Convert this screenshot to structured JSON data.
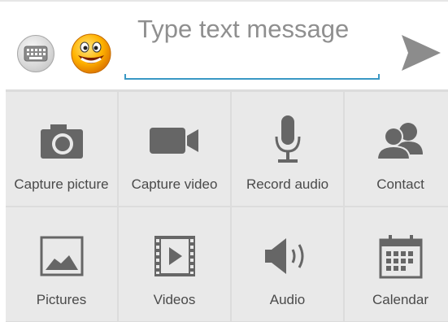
{
  "compose": {
    "placeholder": "Type text message",
    "keyboard_icon": "keyboard-icon",
    "emoji_icon": "smiley-icon",
    "send_icon": "send-icon",
    "accent_color": "#3a98c4"
  },
  "attachments": {
    "row1": [
      {
        "label": "Capture picture",
        "icon": "camera-icon"
      },
      {
        "label": "Capture video",
        "icon": "video-camera-icon"
      },
      {
        "label": "Record audio",
        "icon": "microphone-icon"
      },
      {
        "label": "Contact",
        "icon": "contacts-icon"
      }
    ],
    "row2": [
      {
        "label": "Pictures",
        "icon": "picture-icon"
      },
      {
        "label": "Videos",
        "icon": "film-icon"
      },
      {
        "label": "Audio",
        "icon": "speaker-icon"
      },
      {
        "label": "Calendar",
        "icon": "calendar-icon"
      }
    ]
  }
}
